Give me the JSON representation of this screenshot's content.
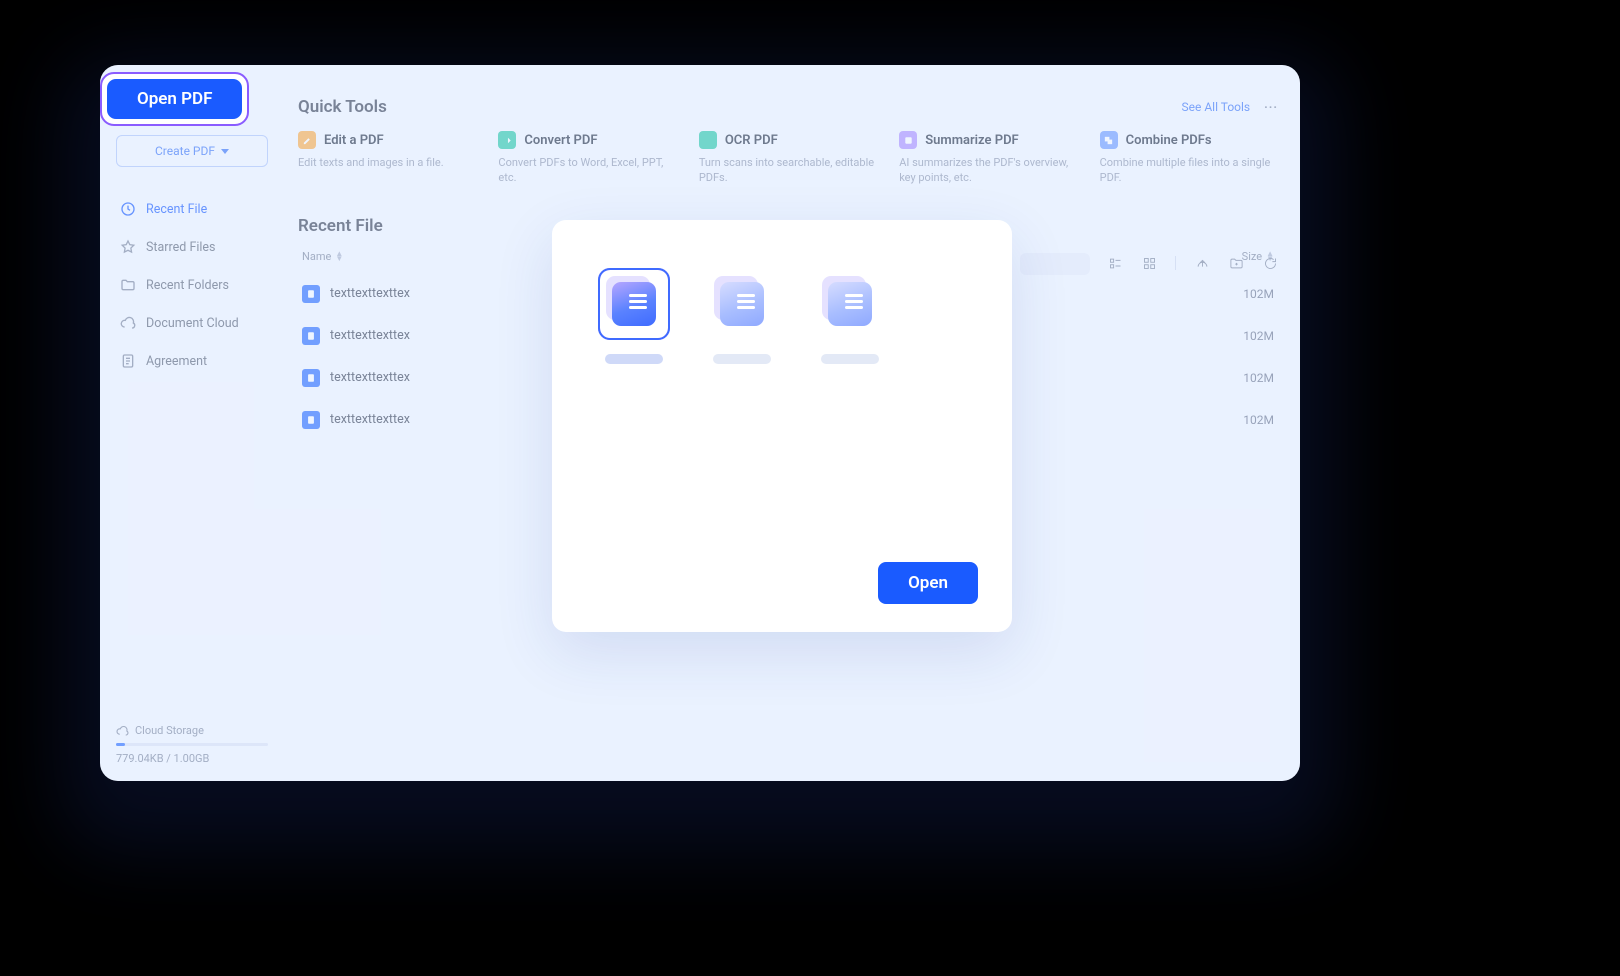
{
  "sidebar": {
    "open_pdf_label": "Open PDF",
    "create_pdf_label": "Create PDF",
    "items": [
      {
        "label": "Recent File"
      },
      {
        "label": "Starred Files"
      },
      {
        "label": "Recent Folders"
      },
      {
        "label": "Document Cloud"
      },
      {
        "label": "Agreement"
      }
    ],
    "cloud_storage_label": "Cloud Storage",
    "storage_text": "779.04KB / 1.00GB"
  },
  "quick_tools": {
    "title": "Quick Tools",
    "see_all_label": "See All Tools",
    "tools": [
      {
        "title": "Edit a PDF",
        "desc": "Edit texts and images in a file."
      },
      {
        "title": "Convert PDF",
        "desc": "Convert PDFs to Word, Excel, PPT, etc."
      },
      {
        "title": "OCR PDF",
        "desc": "Turn scans into searchable, editable PDFs."
      },
      {
        "title": "Summarize PDF",
        "desc": "AI summarizes the PDF's overview, key points, etc."
      },
      {
        "title": "Combine PDFs",
        "desc": "Combine multiple files into a single PDF."
      }
    ]
  },
  "recent": {
    "title": "Recent File",
    "columns": {
      "name": "Name",
      "size": "Size"
    },
    "rows": [
      {
        "name": "texttexttexttex",
        "size": "102M"
      },
      {
        "name": "texttexttexttex",
        "size": "102M"
      },
      {
        "name": "texttexttexttex",
        "size": "102M"
      },
      {
        "name": "texttexttexttex",
        "size": "102M"
      }
    ]
  },
  "dialog": {
    "open_label": "Open"
  }
}
